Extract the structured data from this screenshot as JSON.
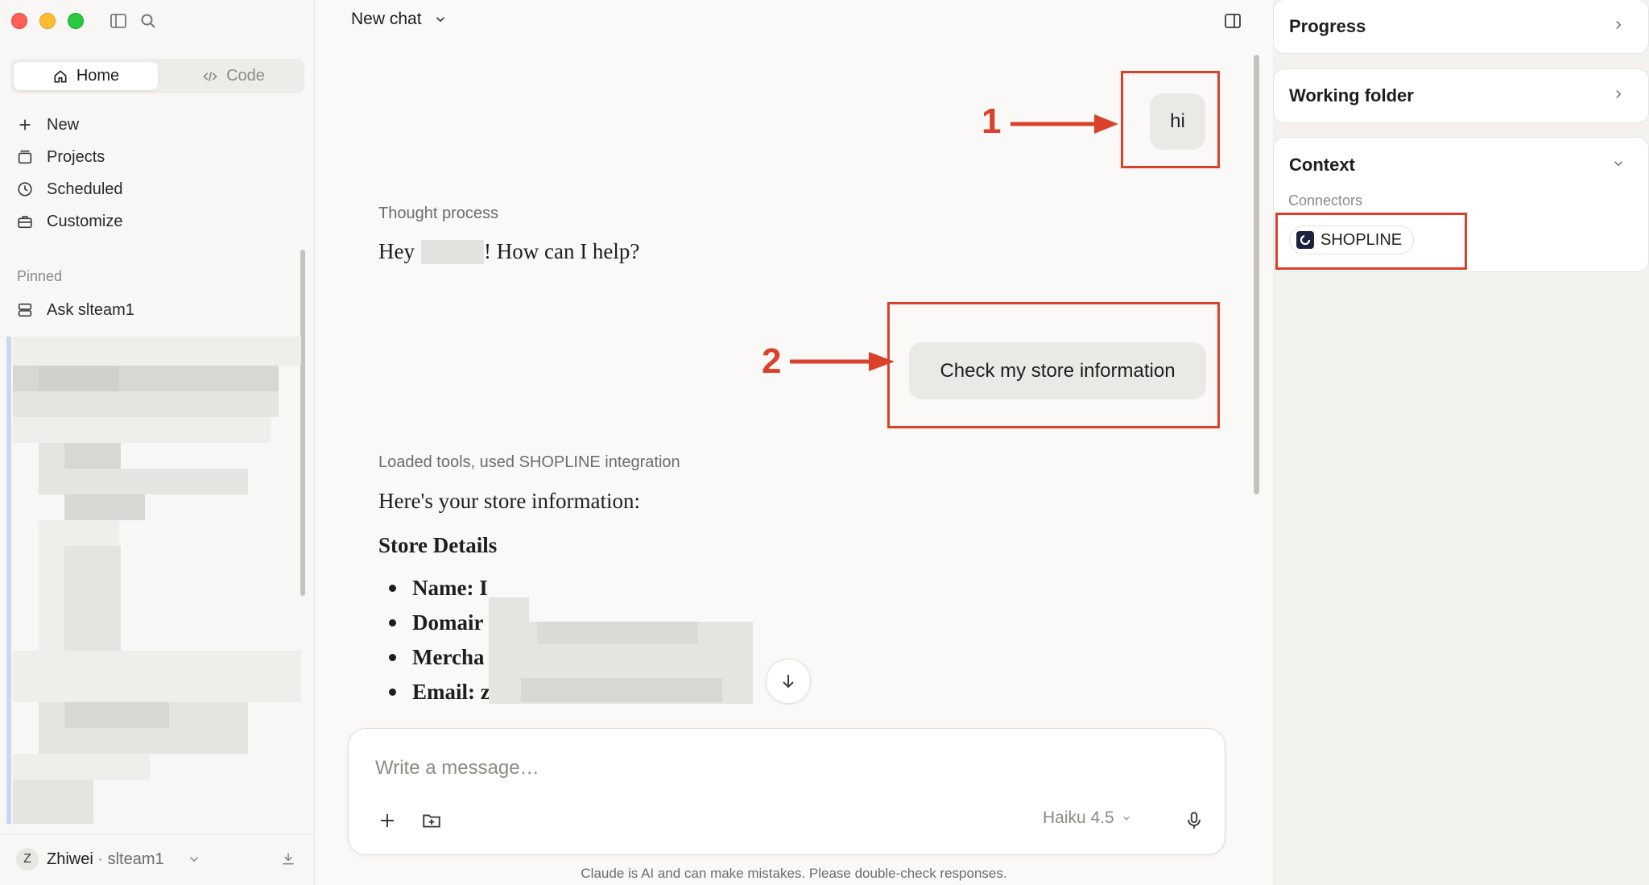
{
  "sidebar": {
    "mode_home": "Home",
    "mode_code": "Code",
    "nav": {
      "new": "New",
      "projects": "Projects",
      "scheduled": "Scheduled",
      "customize": "Customize"
    },
    "pinned_label": "Pinned",
    "pinned_item": "Ask slteam1",
    "user_initial": "Z",
    "user_name": "Zhiwei",
    "user_sep": " · ",
    "user_org": "slteam1"
  },
  "chat": {
    "title": "New chat",
    "user_message_1": "hi",
    "thought_label": "Thought process",
    "reply_hey": "Hey",
    "reply_help": "! How can I help?",
    "user_message_2": "Check my store information",
    "tools_label": "Loaded tools, used SHOPLINE integration",
    "store_intro": "Here's your store information:",
    "store_heading": "Store Details",
    "details": [
      {
        "label": "Name: I"
      },
      {
        "label": "Domair"
      },
      {
        "label": "Mercha"
      },
      {
        "label": "Email: z"
      }
    ]
  },
  "composer": {
    "placeholder": "Write a message…",
    "model": "Haiku 4.5"
  },
  "disclaimer": "Claude is AI and can make mistakes. Please double-check responses.",
  "right_panel": {
    "progress": "Progress",
    "working_folder": "Working folder",
    "context": "Context",
    "connectors_label": "Connectors",
    "connector": "SHOPLINE"
  },
  "annotations": {
    "one": "1",
    "two": "2"
  },
  "colors": {
    "annotation": "#d9412b",
    "user_bubble": "#ebe9e5",
    "sidebar_bg": "#f8f7f5"
  }
}
